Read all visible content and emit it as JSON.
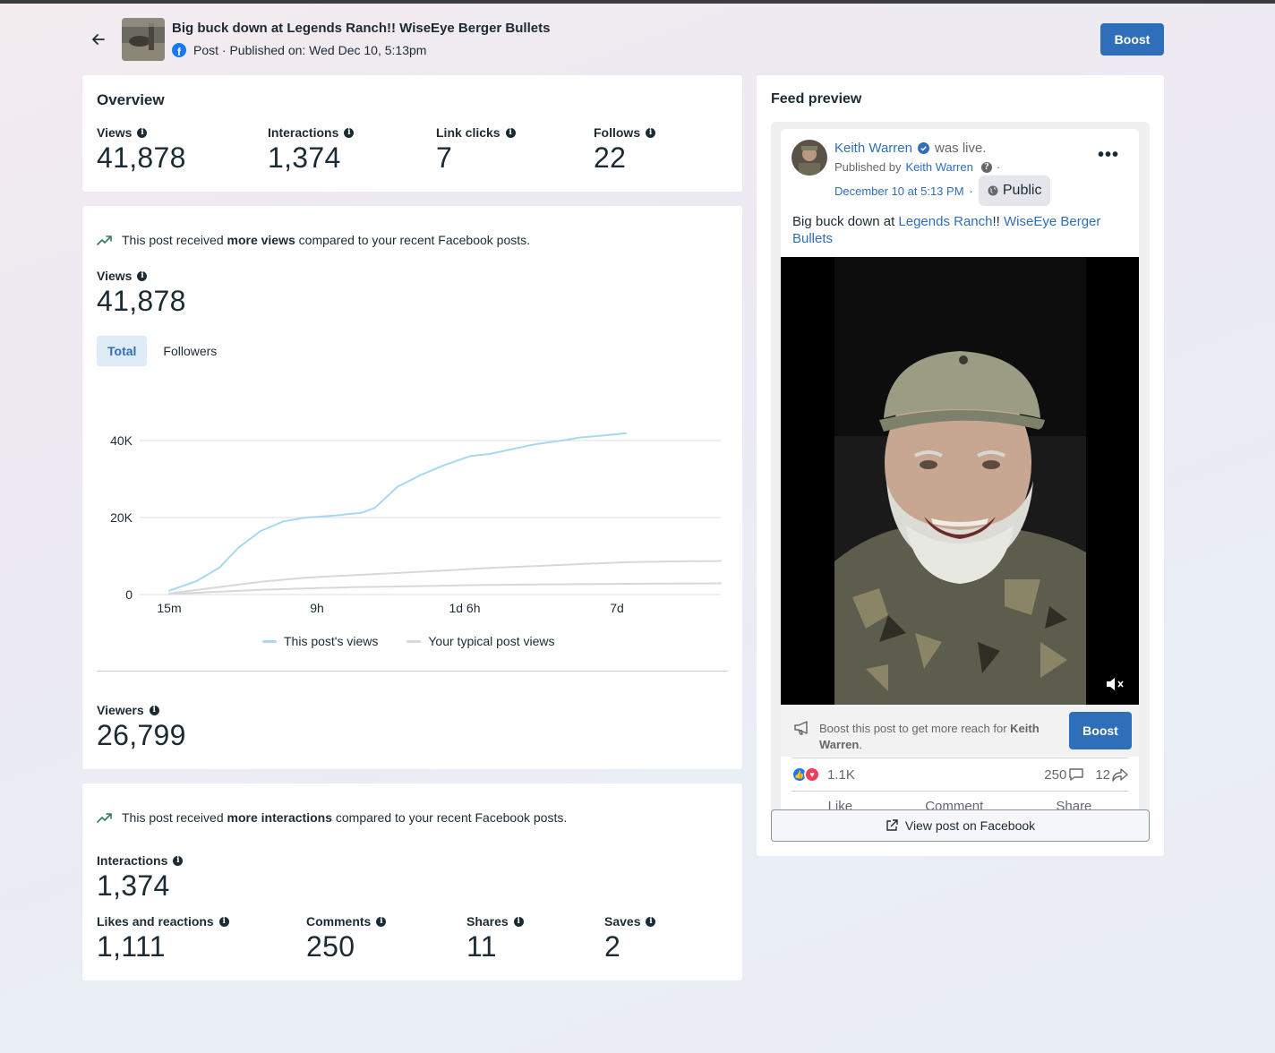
{
  "header": {
    "title": "Big buck down at Legends Ranch!! WiseEye Berger Bullets",
    "subtitle": "Post · Published on: Wed Dec 10, 5:13pm",
    "boost_label": "Boost"
  },
  "overview": {
    "title": "Overview",
    "metrics": [
      {
        "label": "Views",
        "value": "41,878"
      },
      {
        "label": "Interactions",
        "value": "1,374"
      },
      {
        "label": "Link clicks",
        "value": "7"
      },
      {
        "label": "Follows",
        "value": "22"
      }
    ]
  },
  "views_card": {
    "insight_pre": "This post received ",
    "insight_bold": "more views",
    "insight_post": " compared to your recent Facebook posts.",
    "views_label": "Views",
    "views_value": "41,878",
    "tabs": [
      "Total",
      "Followers"
    ],
    "viewers_label": "Viewers",
    "viewers_value": "26,799"
  },
  "chart_data": {
    "type": "line",
    "y_ticks": [
      "40K",
      "20K",
      "0"
    ],
    "x_ticks": [
      "15m",
      "9h",
      "1d 6h",
      "7d"
    ],
    "ylim": [
      0,
      40000
    ],
    "series": [
      {
        "name": "This post's views",
        "color": "#a8d8f0",
        "x": [
          0,
          0.06,
          0.11,
          0.15,
          0.2,
          0.25,
          0.3,
          0.36,
          0.42,
          0.45,
          0.5,
          0.55,
          0.6,
          0.66,
          0.7,
          0.76,
          0.8,
          0.86,
          0.9,
          0.95,
          1.0
        ],
        "values": [
          1000,
          3500,
          7000,
          12000,
          16500,
          19000,
          20000,
          20500,
          21200,
          22500,
          28000,
          31000,
          33500,
          36000,
          36500,
          38000,
          39000,
          40000,
          40800,
          41300,
          41878
        ]
      },
      {
        "name": "Your typical post views",
        "color": "#d6d9dc",
        "x": [
          0,
          0.1,
          0.2,
          0.3,
          0.4,
          0.5,
          0.6,
          0.7,
          0.8,
          0.9,
          1.0,
          1.1,
          1.2,
          1.3
        ],
        "values": [
          300,
          1800,
          3300,
          4400,
          5000,
          5600,
          6200,
          6900,
          7400,
          7900,
          8400,
          8600,
          8700,
          8800
        ]
      },
      {
        "name": "Your typical post views (lower)",
        "color": "#d6d9dc",
        "x": [
          0,
          0.1,
          0.2,
          0.3,
          0.4,
          0.5,
          0.6,
          0.7,
          0.8,
          0.9,
          1.0,
          1.1,
          1.2,
          1.3
        ],
        "values": [
          100,
          700,
          1200,
          1600,
          1900,
          2100,
          2300,
          2500,
          2600,
          2700,
          2800,
          2850,
          2900,
          2950
        ]
      }
    ]
  },
  "chart_legend": [
    "This post's views",
    "Your typical post views"
  ],
  "interactions_card": {
    "insight_pre": "This post received ",
    "insight_bold": "more interactions",
    "insight_post": " compared to your recent Facebook posts.",
    "label": "Interactions",
    "value": "1,374",
    "breakdown": [
      {
        "label": "Likes and reactions",
        "value": "1,111"
      },
      {
        "label": "Comments",
        "value": "250"
      },
      {
        "label": "Shares",
        "value": "11"
      },
      {
        "label": "Saves",
        "value": "2"
      }
    ]
  },
  "preview": {
    "title": "Feed preview",
    "author": "Keith Warren",
    "was_live": "was live.",
    "published_by": "Published by",
    "published_by_name": "Keith Warren",
    "date": "December 10 at 5:13 PM",
    "audience": "Public",
    "text_1": "Big buck down at ",
    "text_link_1": "Legends Ranch",
    "text_2": "!! ",
    "text_link_2": "WiseEye Berger Bullets",
    "boost_text_pre": "Boost this post to get more reach for ",
    "boost_text_name": "Keith Warren",
    "boost_text_post": ".",
    "boost_label": "Boost",
    "reactions": "1.1K",
    "comments": "250",
    "shares": "12",
    "actions": [
      "Like",
      "Comment",
      "Share"
    ],
    "view_on_facebook": "View post on Facebook"
  }
}
